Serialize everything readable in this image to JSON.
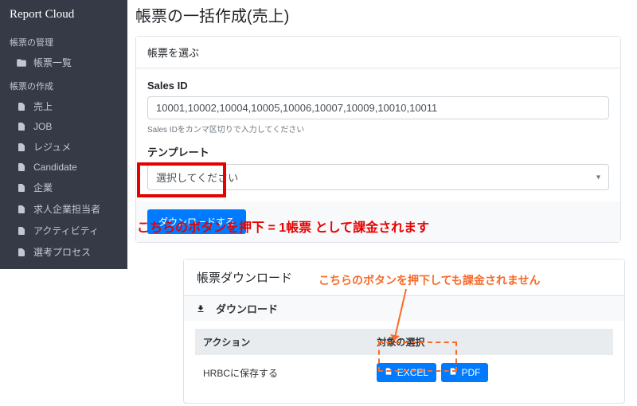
{
  "brand": "Report Cloud",
  "sidebar": {
    "section1_title": "帳票の管理",
    "section1_items": [
      {
        "label": "帳票一覧",
        "icon": "folder-open"
      }
    ],
    "section2_title": "帳票の作成",
    "section2_items": [
      {
        "label": "売上",
        "icon": "file"
      },
      {
        "label": "JOB",
        "icon": "file"
      },
      {
        "label": "レジュメ",
        "icon": "file"
      },
      {
        "label": "Candidate",
        "icon": "file"
      },
      {
        "label": "企業",
        "icon": "file"
      },
      {
        "label": "求人企業担当者",
        "icon": "file"
      },
      {
        "label": "アクティビティ",
        "icon": "file"
      },
      {
        "label": "選考プロセス",
        "icon": "file"
      }
    ]
  },
  "page": {
    "title": "帳票の一括作成(売上)",
    "panel_header": "帳票を選ぶ",
    "field1_label": "Sales ID",
    "field1_value": "10001,10002,10004,10005,10006,10007,10009,10010,10011",
    "field1_help": "Sales IDをカンマ区切りで入力してください",
    "field2_label": "テンプレート",
    "field2_selected": "選択してください",
    "download_button": "ダウンロードする"
  },
  "annotations": {
    "text1": "こちらのボタンを押下 = 1帳票 として課金されます",
    "text2": "こちらのボタンを押下しても課金されません"
  },
  "download_panel": {
    "header": "帳票ダウンロード",
    "subheader": "ダウンロード",
    "col1": "アクション",
    "col2": "対象の選択",
    "row1_action": "HRBCに保存する",
    "excel_btn": "EXCEL",
    "pdf_btn": "PDF"
  }
}
